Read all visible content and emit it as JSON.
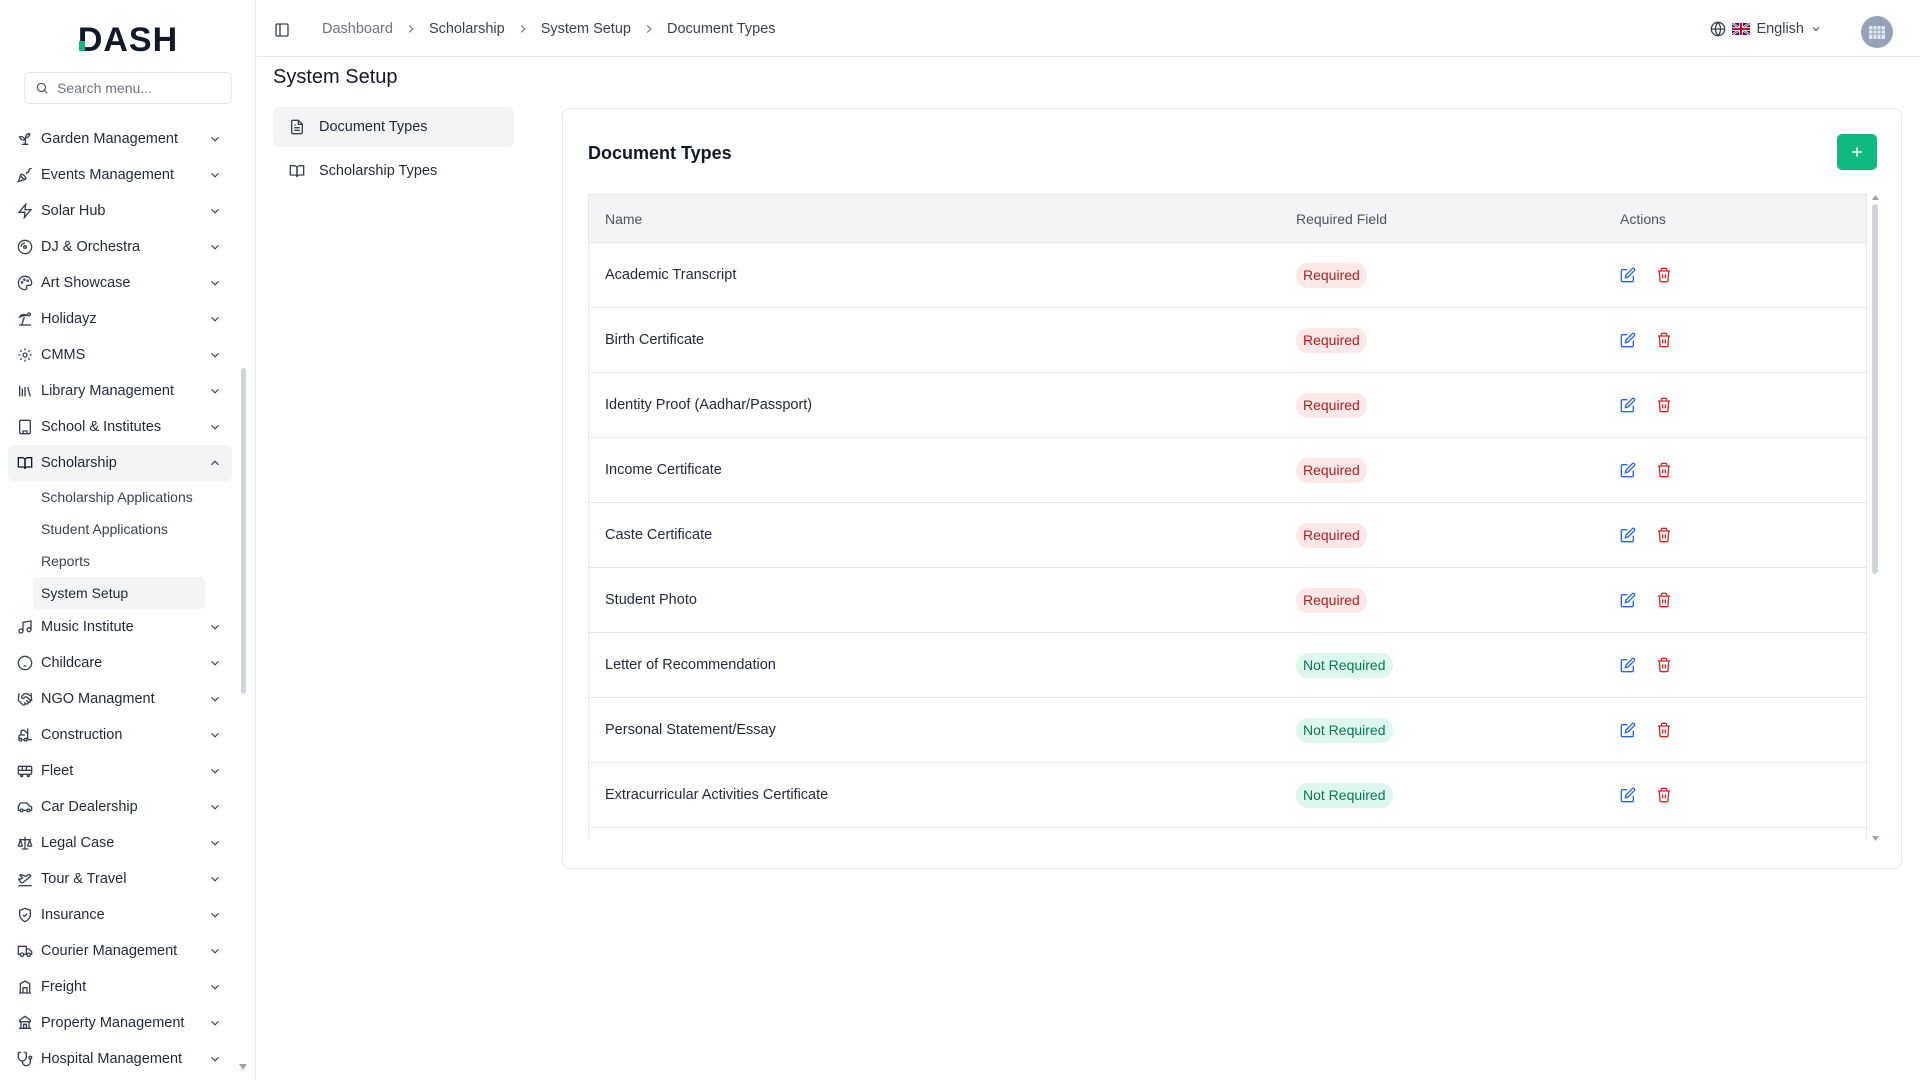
{
  "app": {
    "logo_text": "DASH"
  },
  "colors": {
    "accent": "#10b981",
    "danger": "#dc2626",
    "edit": "#2563eb"
  },
  "sidebar": {
    "search_placeholder": "Search menu...",
    "items": [
      {
        "label": "Garden Management",
        "icon": "sprout-icon"
      },
      {
        "label": "Events Management",
        "icon": "party-popper-icon"
      },
      {
        "label": "Solar Hub",
        "icon": "zap-icon"
      },
      {
        "label": "DJ & Orchestra",
        "icon": "disc-icon"
      },
      {
        "label": "Art Showcase",
        "icon": "palette-icon"
      },
      {
        "label": "Holidayz",
        "icon": "beach-icon"
      },
      {
        "label": "CMMS",
        "icon": "gear-icon"
      },
      {
        "label": "Library Management",
        "icon": "library-icon"
      },
      {
        "label": "School & Institutes",
        "icon": "building-icon"
      },
      {
        "label": "Scholarship",
        "icon": "book-open-icon",
        "expanded": true,
        "children": [
          "Scholarship Applications",
          "Student Applications",
          "Reports",
          "System Setup"
        ],
        "active_child": "System Setup"
      },
      {
        "label": "Music Institute",
        "icon": "music-icon"
      },
      {
        "label": "Childcare",
        "icon": "baby-icon"
      },
      {
        "label": "NGO Managment",
        "icon": "handshake-icon"
      },
      {
        "label": "Construction",
        "icon": "forklift-icon"
      },
      {
        "label": "Fleet",
        "icon": "bus-icon"
      },
      {
        "label": "Car Dealership",
        "icon": "car-icon"
      },
      {
        "label": "Legal Case",
        "icon": "scale-icon"
      },
      {
        "label": "Tour & Travel",
        "icon": "plane-icon"
      },
      {
        "label": "Insurance",
        "icon": "shield-icon"
      },
      {
        "label": "Courier Management",
        "icon": "truck-icon"
      },
      {
        "label": "Freight",
        "icon": "container-icon"
      },
      {
        "label": "Property Management",
        "icon": "property-icon"
      },
      {
        "label": "Hospital Management",
        "icon": "stethoscope-icon"
      }
    ]
  },
  "header": {
    "breadcrumb": [
      "Dashboard",
      "Scholarship",
      "System Setup",
      "Document Types"
    ],
    "language": "English"
  },
  "page": {
    "title": "System Setup",
    "subnav": [
      {
        "label": "Document Types",
        "icon": "file-text-icon",
        "active": true
      },
      {
        "label": "Scholarship Types",
        "icon": "book-open-icon",
        "active": false
      }
    ]
  },
  "card": {
    "title": "Document Types",
    "add_label": "+",
    "columns": {
      "name": "Name",
      "required": "Required Field",
      "actions": "Actions"
    },
    "rows": [
      {
        "name": "Academic Transcript",
        "status": "Required"
      },
      {
        "name": "Birth Certificate",
        "status": "Required"
      },
      {
        "name": "Identity Proof (Aadhar/Passport)",
        "status": "Required"
      },
      {
        "name": "Income Certificate",
        "status": "Required"
      },
      {
        "name": "Caste Certificate",
        "status": "Required"
      },
      {
        "name": "Student Photo",
        "status": "Required"
      },
      {
        "name": "Letter of Recommendation",
        "status": "Not Required"
      },
      {
        "name": "Personal Statement/Essay",
        "status": "Not Required"
      },
      {
        "name": "Extracurricular Activities Certificate",
        "status": "Not Required"
      }
    ]
  }
}
